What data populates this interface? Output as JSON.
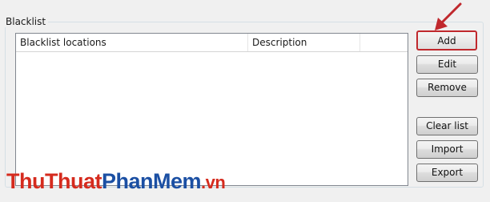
{
  "group": {
    "title": "Blacklist"
  },
  "list": {
    "columns": [
      "Blacklist locations",
      "Description"
    ],
    "rows": []
  },
  "buttons": {
    "add": "Add",
    "edit": "Edit",
    "remove": "Remove",
    "clear_list": "Clear list",
    "import": "Import",
    "export": "Export"
  },
  "annotation": {
    "icon": "red-arrow-icon",
    "highlight_color": "#c0282d"
  },
  "watermark": {
    "part1": "ThuThuat",
    "part2": "PhanMem",
    "part3": ".vn"
  }
}
